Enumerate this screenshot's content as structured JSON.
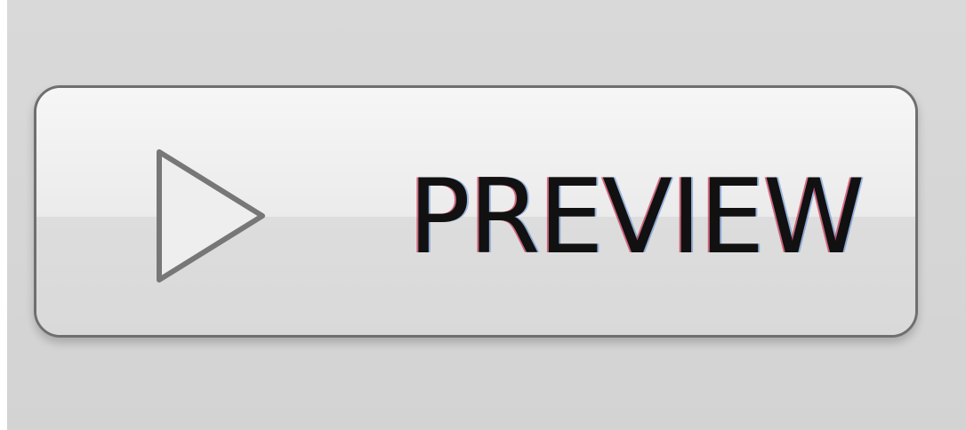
{
  "screen": {
    "background_color": "#d6d6d6"
  },
  "button": {
    "label": "PREVIEW",
    "icon": "play-icon"
  },
  "colors": {
    "button_fill": "#e8e8e8",
    "button_border": "#6f6f6f",
    "text": "#111111"
  }
}
